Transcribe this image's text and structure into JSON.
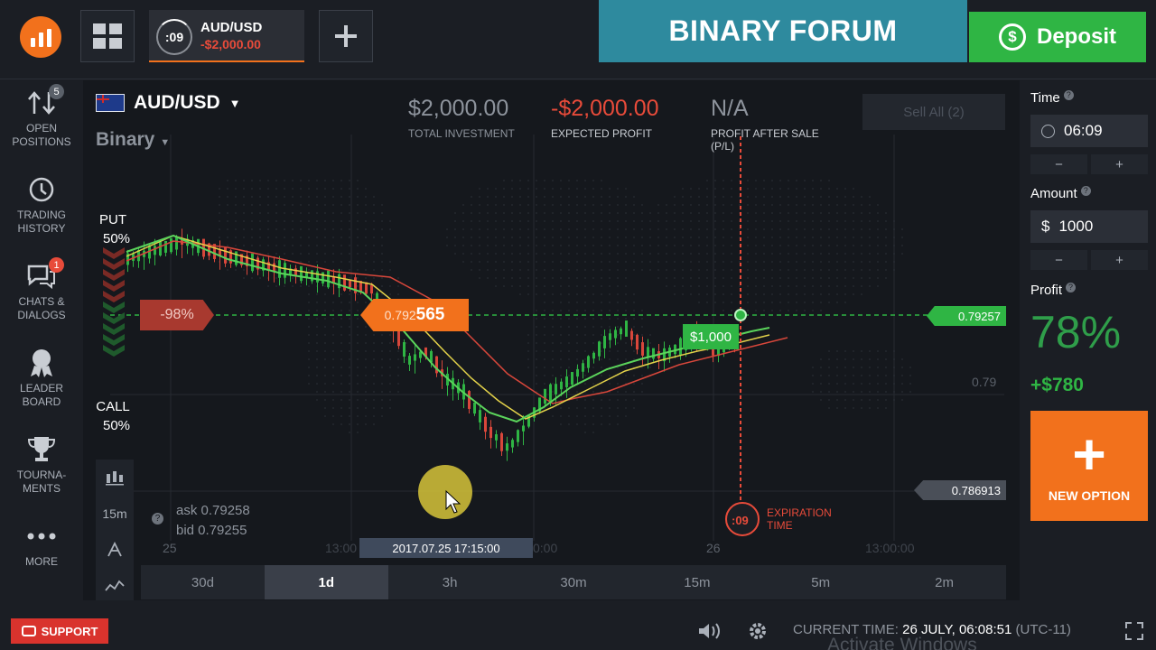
{
  "header": {
    "asset_tab": {
      "timer": ":09",
      "name": "AUD/USD",
      "value": "-$2,000.00"
    },
    "banner": "BINARY FORUM",
    "deposit_label": "Deposit"
  },
  "leftnav": [
    {
      "label1": "OPEN",
      "label2": "POSITIONS",
      "badge": "5",
      "icon": "arrows-icon"
    },
    {
      "label1": "TRADING",
      "label2": "HISTORY",
      "badge": "",
      "icon": "history-icon"
    },
    {
      "label1": "CHATS &",
      "label2": "DIALOGS",
      "badge": "1",
      "icon": "chat-icon"
    },
    {
      "label1": "LEADER",
      "label2": "BOARD",
      "badge": "",
      "icon": "medal-icon"
    },
    {
      "label1": "TOURNA-",
      "label2": "MENTS",
      "badge": "",
      "icon": "trophy-icon"
    },
    {
      "label1": "MORE",
      "label2": "",
      "badge": "",
      "icon": "more-icon"
    }
  ],
  "chart": {
    "asset": "AUD/USD",
    "mode": "Binary",
    "total_investment": "$2,000.00",
    "total_investment_label": "TOTAL INVESTMENT",
    "expected_profit": "-$2,000.00",
    "expected_profit_label": "EXPECTED PROFIT",
    "profit_after_sale": "N/A",
    "profit_after_sale_label1": "PROFIT AFTER SALE",
    "profit_after_sale_label2": "(P/L)",
    "sell_all": "Sell All (2)",
    "put_label": "PUT",
    "put_pct": "50%",
    "call_label": "CALL",
    "call_pct": "50%",
    "loss_pct": "-98%",
    "entry_price_prefix": "0.792",
    "entry_price_suffix": "565",
    "position_value": "$1,000",
    "current_price": "0.79257",
    "level_079": "0.79",
    "level_low": "0.786913",
    "ask": "ask 0.79258",
    "bid": "bid 0.79255",
    "timeframe": "15m",
    "expiration_timer": ":09",
    "expiration_label1": "EXPIRATION",
    "expiration_label2": "TIME",
    "x_ticks": [
      "25",
      "13:00",
      "2017.07.25 17:15:00",
      "0:00",
      "26",
      "13:00:00"
    ],
    "ranges": [
      "30d",
      "1d",
      "3h",
      "30m",
      "15m",
      "5m",
      "2m"
    ],
    "active_range": "1d"
  },
  "right": {
    "time_label": "Time",
    "time_value": "06:09",
    "amount_label": "Amount",
    "amount_currency": "$",
    "amount_value": "1000",
    "minus": "−",
    "plus": "+",
    "profit_label": "Profit",
    "profit_pct": "78%",
    "profit_value": "+$780",
    "new_option": "NEW OPTION"
  },
  "bottom": {
    "support": "SUPPORT",
    "current_time_label": "CURRENT TIME:",
    "current_time_value": "26 JULY, 06:08:51",
    "timezone": "(UTC-11)",
    "watermark": "Activate Windows"
  },
  "colors": {
    "accent": "#f2711c",
    "up": "#2fb544",
    "down": "#e84b3a",
    "banner": "#2e8a9e"
  }
}
